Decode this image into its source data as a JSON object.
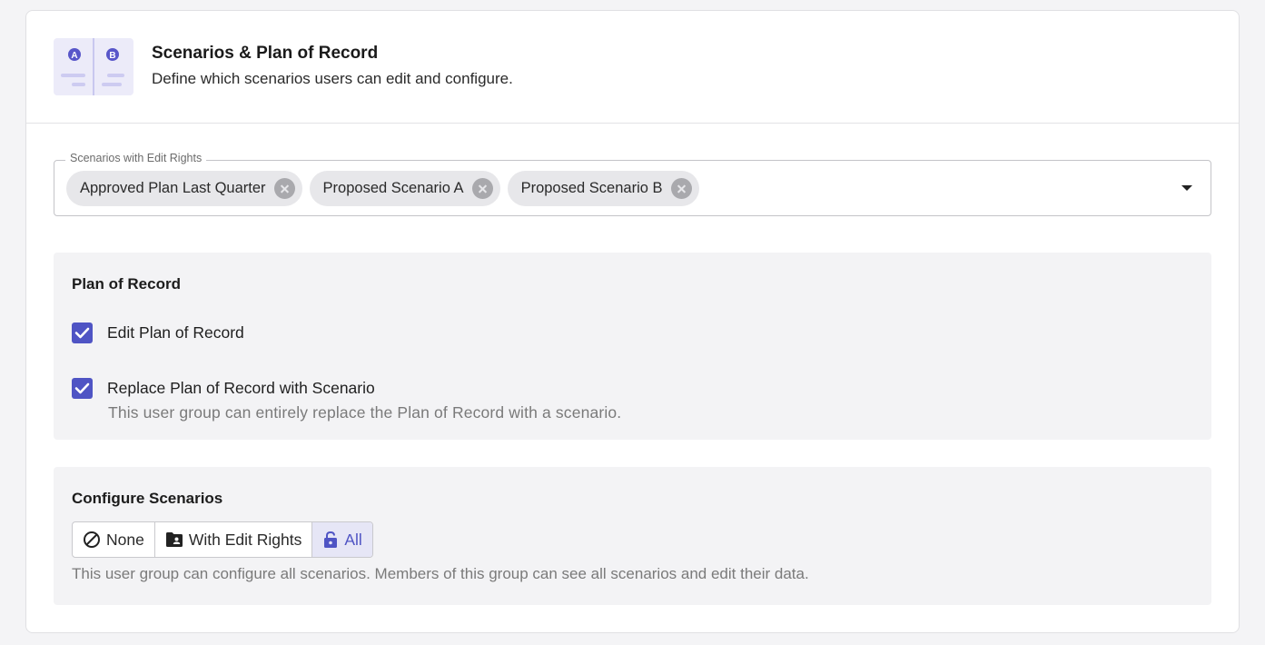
{
  "header": {
    "illustration_icon": "scenario-ab-icon",
    "illustration_letters": [
      "A",
      "B"
    ],
    "title": "Scenarios & Plan of Record",
    "subtitle": "Define which scenarios users can edit and configure."
  },
  "edit_rights_field": {
    "label": "Scenarios with Edit Rights",
    "chips": [
      {
        "label": "Approved Plan Last Quarter"
      },
      {
        "label": "Proposed Scenario A"
      },
      {
        "label": "Proposed Scenario B"
      }
    ]
  },
  "plan_of_record": {
    "title": "Plan of Record",
    "edit": {
      "label": "Edit Plan of Record",
      "checked": true
    },
    "replace": {
      "label": "Replace Plan of Record with Scenario",
      "help": "This user group can entirely replace the Plan of Record with a scenario.",
      "checked": true
    }
  },
  "configure_scenarios": {
    "title": "Configure Scenarios",
    "options": [
      {
        "label": "None",
        "icon": "block-icon",
        "selected": false
      },
      {
        "label": "With Edit Rights",
        "icon": "folder-shared-icon",
        "selected": false
      },
      {
        "label": "All",
        "icon": "lock-open-icon",
        "selected": true
      }
    ],
    "help": "This user group can configure all scenarios. Members of this group can see all scenarios and edit their data."
  },
  "colors": {
    "accent": "#4f54c4",
    "section_bg": "#f3f3f5",
    "chip_bg": "#e7e7ea",
    "illustration_bg": "#ecebf9"
  }
}
